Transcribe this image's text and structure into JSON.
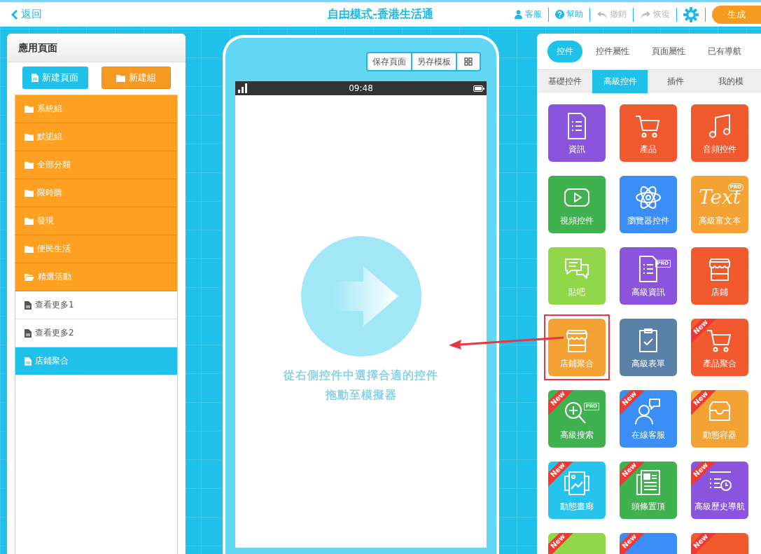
{
  "topbar": {
    "back": "返回",
    "title": "自由模式-香港生活通",
    "actions": [
      {
        "kind": "person",
        "label": "客服",
        "disabled": false
      },
      {
        "kind": "help",
        "label": "幫助",
        "disabled": false
      },
      {
        "kind": "undo",
        "label": "撤銷",
        "disabled": true
      },
      {
        "kind": "redo",
        "label": "恢復",
        "disabled": true
      }
    ],
    "generate": "生成"
  },
  "pages_panel": {
    "title": "應用頁面",
    "new_page": "新建頁面",
    "new_group": "新建組",
    "items": [
      {
        "kind": "folder",
        "label": "系統組",
        "selected": false
      },
      {
        "kind": "folder",
        "label": "默認組",
        "selected": false
      },
      {
        "kind": "folder",
        "label": "全部分類",
        "selected": false
      },
      {
        "kind": "folder",
        "label": "限時購",
        "selected": false
      },
      {
        "kind": "folder",
        "label": "發現",
        "selected": false
      },
      {
        "kind": "folder",
        "label": "便民生活",
        "selected": false
      },
      {
        "kind": "open-folder",
        "label": "精選活動",
        "selected": false
      },
      {
        "kind": "page",
        "label": "查看更多1",
        "selected": false
      },
      {
        "kind": "page",
        "label": "查看更多2",
        "selected": false
      },
      {
        "kind": "page",
        "label": "店鋪聚合",
        "selected": true
      }
    ]
  },
  "phone": {
    "toolbar": [
      "保存頁面",
      "另存模板"
    ],
    "time": "09:48",
    "hint": [
      "從右側控件中選擇合適的控件",
      "拖動至模擬器"
    ]
  },
  "widgets_panel": {
    "tabs": [
      {
        "label": "控件",
        "selected": true
      },
      {
        "label": "控件屬性",
        "selected": false
      },
      {
        "label": "頁面屬性",
        "selected": false
      },
      {
        "label": "已有導航",
        "selected": false
      }
    ],
    "subtabs": [
      {
        "label": "基礎控件",
        "selected": false
      },
      {
        "label": "高級控件",
        "selected": true
      },
      {
        "label": "插件",
        "selected": false
      },
      {
        "label": "我的模",
        "selected": false
      }
    ],
    "tiles": [
      {
        "label": "資訊",
        "color": "#8a55dc",
        "highlighted": false
      },
      {
        "label": "產品",
        "color": "#f05a2e",
        "highlighted": false
      },
      {
        "label": "音頻控件",
        "color": "#f05a2e",
        "highlighted": false
      },
      {
        "label": "視頻控件",
        "color": "#3fb14e",
        "highlighted": false
      },
      {
        "label": "瀏覽器控件",
        "color": "#3a8ef5",
        "highlighted": false
      },
      {
        "label": "高級富文本",
        "color": "#f3a233",
        "icon_text": "Text",
        "pro_tag": "PRO",
        "highlighted": false
      },
      {
        "label": "貼吧",
        "color": "#92d64a",
        "highlighted": false
      },
      {
        "label": "高級資訊",
        "color": "#8a55dc",
        "pro_tag": "PRO",
        "highlighted": false
      },
      {
        "label": "店鋪",
        "color": "#f05a2e",
        "highlighted": false
      },
      {
        "label": "店鋪聚合",
        "color": "#f3a233",
        "highlighted": true
      },
      {
        "label": "高級表單",
        "color": "#5a80a8",
        "highlighted": false
      },
      {
        "label": "產品聚合",
        "color": "#f05a2e",
        "badge": "New",
        "highlighted": false
      },
      {
        "label": "高級搜索",
        "color": "#3fb14e",
        "badge": "New",
        "pro_tag": "PRO",
        "highlighted": false
      },
      {
        "label": "在線客服",
        "color": "#3a8ef5",
        "badge": "New",
        "highlighted": false
      },
      {
        "label": "動態容器",
        "color": "#f3a233",
        "badge": "New",
        "highlighted": false
      },
      {
        "label": "動態畫廊",
        "color": "#27c3ef",
        "badge": "New",
        "highlighted": false
      },
      {
        "label": "頭條置頂",
        "color": "#3fb14e",
        "badge": "New",
        "highlighted": false
      },
      {
        "label": "高級歷史導航",
        "color": "#8a55dc",
        "badge": "New",
        "highlighted": false
      },
      {
        "color": "#92d64a",
        "badge": "New",
        "highlighted": false
      },
      {
        "color": "#3a8ef5",
        "badge": "New",
        "highlighted": false
      },
      {
        "color": "#f05a2e",
        "badge": "New",
        "highlighted": false
      }
    ]
  }
}
